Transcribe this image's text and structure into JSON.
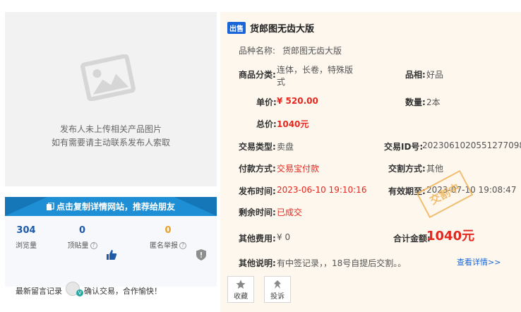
{
  "left": {
    "photo_text1": "发布人未上传相关产品图片",
    "photo_text2": "如有需要请主动联系发布人索取",
    "share_label": "点击复制详情网站，推荐给朋友",
    "stats": {
      "views": {
        "value": "304",
        "label": "浏览量"
      },
      "likes": {
        "value": "0",
        "label": "顶贴量"
      },
      "reports": {
        "value": "0",
        "label": "匿名举报"
      }
    },
    "message_label": "最新留言记录",
    "message_text": "确认交易，合作愉快！"
  },
  "right": {
    "tag": "出售",
    "title": "货郎图无齿大版",
    "fields": {
      "variety_label": "品种名称:",
      "variety_value": "货郎图无齿大版",
      "category_label": "商品分类:",
      "category_value_1": "连体，长卷，特殊版",
      "category_value_2": "式",
      "quality_label": "品相:",
      "quality_value": "好品",
      "unit_price_label": "单价:",
      "unit_price_value": "¥ 520.00",
      "quantity_label": "数量:",
      "quantity_value": "2本",
      "total_label": "总价:",
      "total_value": "1040元",
      "trade_type_label": "交易类型:",
      "trade_type_value": "卖盘",
      "trade_id_label": "交易ID号:",
      "trade_id_value": "2023061020551277098",
      "payment_label": "付款方式:",
      "payment_value": "交易宝付款",
      "delivery_label": "交割方式:",
      "delivery_value": "其他",
      "publish_label": "发布时间:",
      "publish_value": "2023-06-10 19:10:16",
      "valid_label": "有效期至:",
      "valid_value": "2023-07-10 19:08:47",
      "remaining_label": "剩余时间:",
      "remaining_value": "已成交",
      "other_fee_label": "其他费用:",
      "other_fee_value": "¥ 0",
      "sum_label": "合计金额:",
      "sum_value": "1040元",
      "note_label": "其他说明:",
      "note_value": "有中签记录，，18号自提后交割。。",
      "detail_link": "查看详情>>"
    },
    "stamp": "交割中",
    "buttons": {
      "favorite": "收藏",
      "complain": "投诉"
    }
  },
  "colors": {
    "accent_blue": "#1e8fd4",
    "price_red": "#e4281f",
    "stamp_orange": "#f0b45a",
    "panel_bg": "#fdf7ee"
  }
}
